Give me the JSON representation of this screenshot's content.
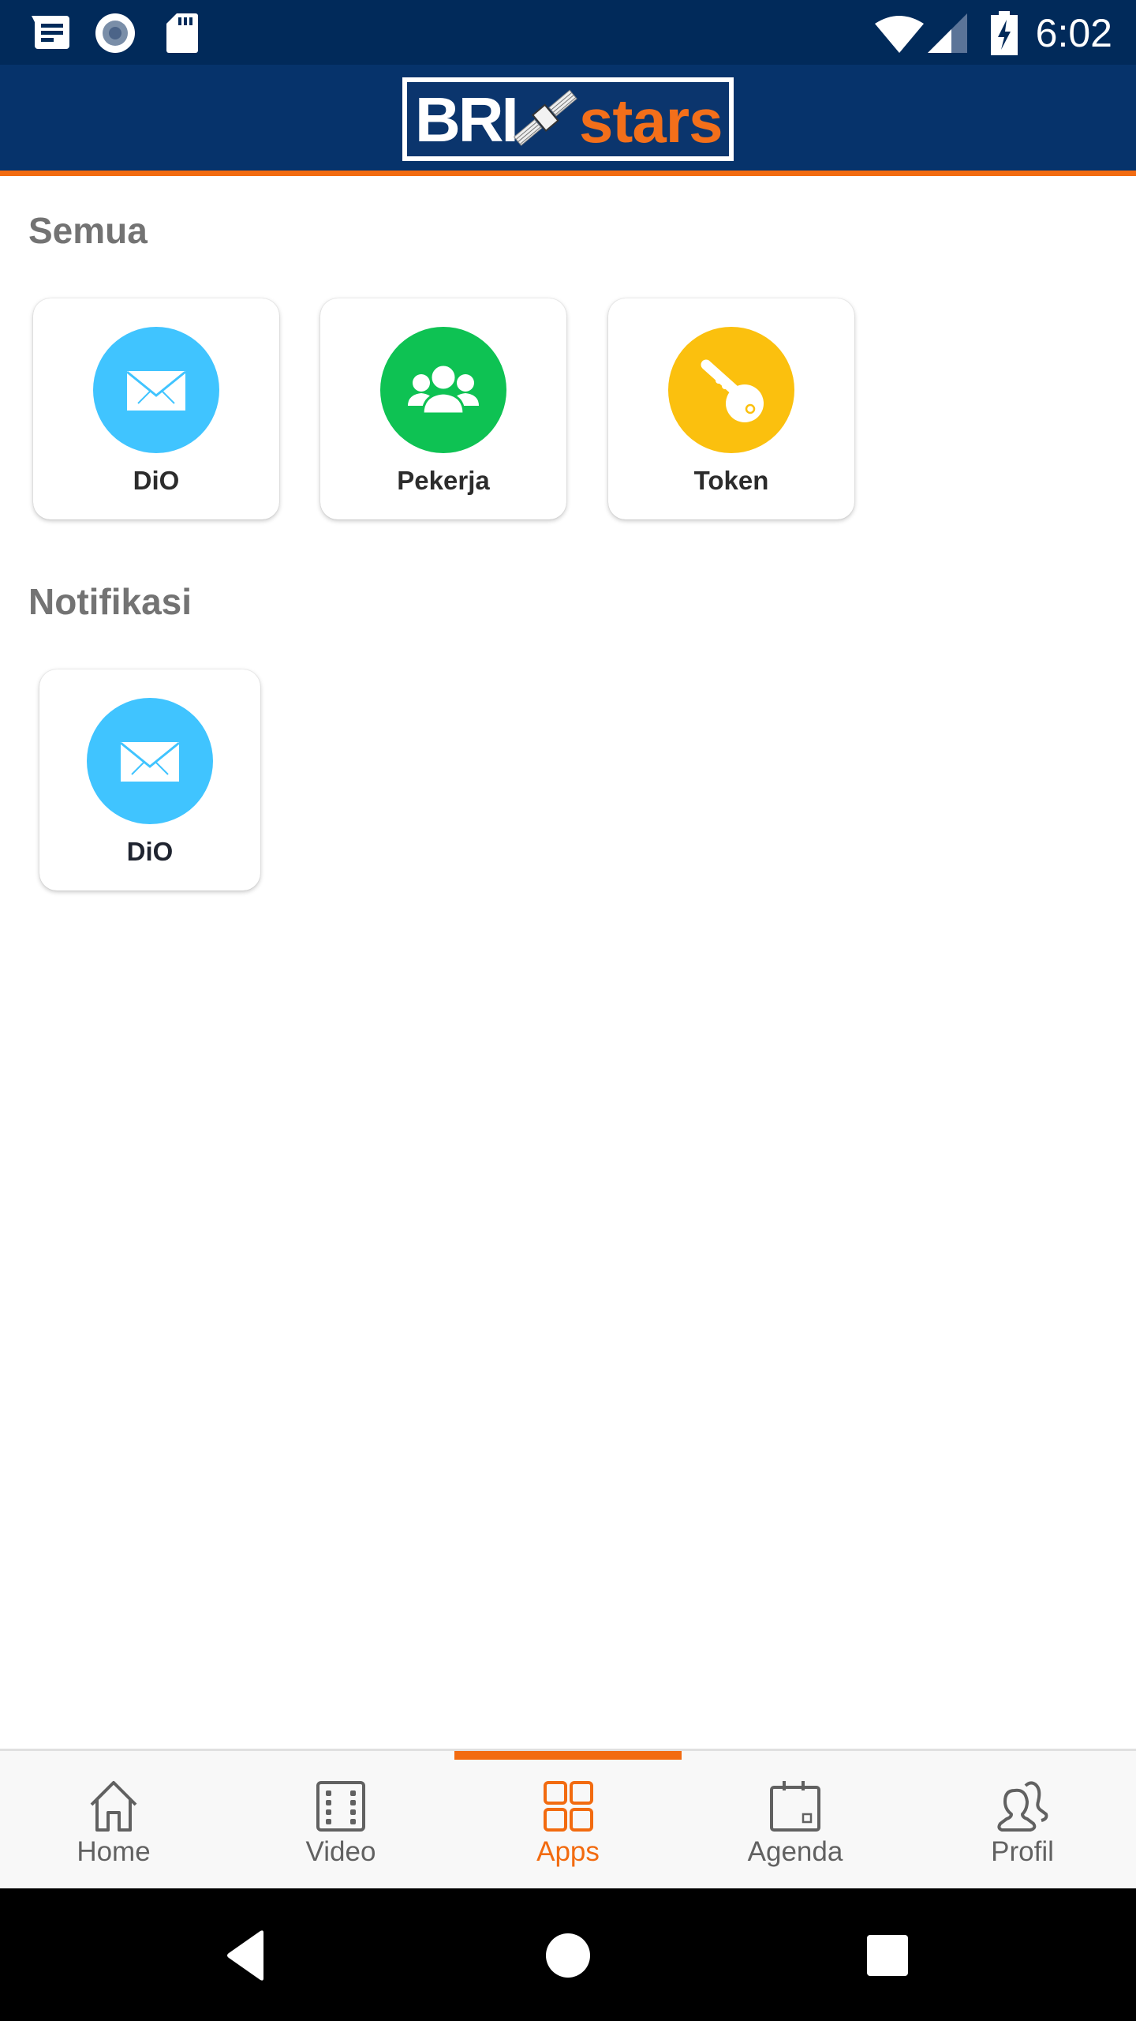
{
  "status_bar": {
    "time": "6:02",
    "left_icons": [
      "message-icon",
      "record-icon",
      "sd-card-icon"
    ],
    "right_icons": [
      "wifi-icon",
      "cell-signal-icon",
      "battery-charging-icon"
    ]
  },
  "header": {
    "logo_text_primary": "BRI",
    "logo_text_secondary": "stars",
    "accent_color": "#f26b10",
    "brand_color": "#06336b"
  },
  "sections": [
    {
      "title": "Semua",
      "apps": [
        {
          "label": "DiO",
          "icon": "mail-icon",
          "color": "#40c4ff"
        },
        {
          "label": "Pekerja",
          "icon": "people-icon",
          "color": "#0ec253"
        },
        {
          "label": "Token",
          "icon": "key-icon",
          "color": "#fbc00e"
        }
      ]
    },
    {
      "title": "Notifikasi",
      "apps": [
        {
          "label": "DiO",
          "icon": "mail-icon",
          "color": "#40c4ff"
        }
      ]
    }
  ],
  "bottom_nav": {
    "active": "Apps",
    "items": [
      {
        "label": "Home",
        "icon": "home-icon"
      },
      {
        "label": "Video",
        "icon": "film-icon"
      },
      {
        "label": "Apps",
        "icon": "grid-icon"
      },
      {
        "label": "Agenda",
        "icon": "calendar-icon"
      },
      {
        "label": "Profil",
        "icon": "profile-icon"
      }
    ]
  },
  "system_nav": {
    "buttons": [
      "back",
      "home",
      "recents"
    ]
  }
}
